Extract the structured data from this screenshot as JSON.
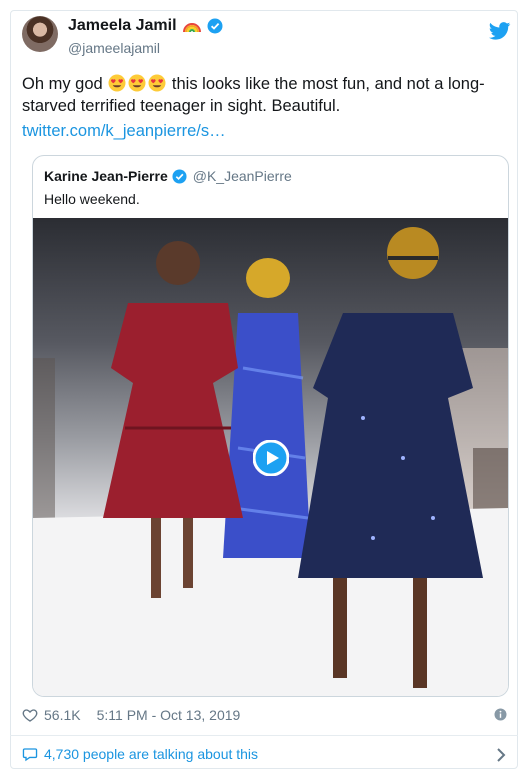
{
  "tweet": {
    "author": {
      "name": "Jameela Jamil",
      "handle": "@jameelajamil"
    },
    "text_before_emoji": "Oh my god",
    "emoji": [
      "heart-eyes",
      "heart-eyes",
      "heart-eyes"
    ],
    "text_after_emoji": " this looks like the most fun, and not a long-starved terrified teenager in sight. Beautiful.",
    "link": "twitter.com/k_jeanpierre/s…",
    "likes": "56.1K",
    "timestamp": "5:11 PM - Oct 13, 2019",
    "talking": "4,730 people are talking about this"
  },
  "quoted": {
    "name": "Karine Jean-Pierre",
    "handle": "@K_JeanPierre",
    "text": "Hello weekend."
  },
  "colors": {
    "accent": "#1b95e0",
    "text": "#14171a",
    "muted": "#657786",
    "border": "#e1e8ed"
  },
  "icons": [
    "verified-badge-icon",
    "rainbow-icon",
    "twitter-bird-icon",
    "play-icon",
    "heart-icon",
    "info-icon",
    "comment-bubble-icon",
    "chevron-right-icon"
  ]
}
